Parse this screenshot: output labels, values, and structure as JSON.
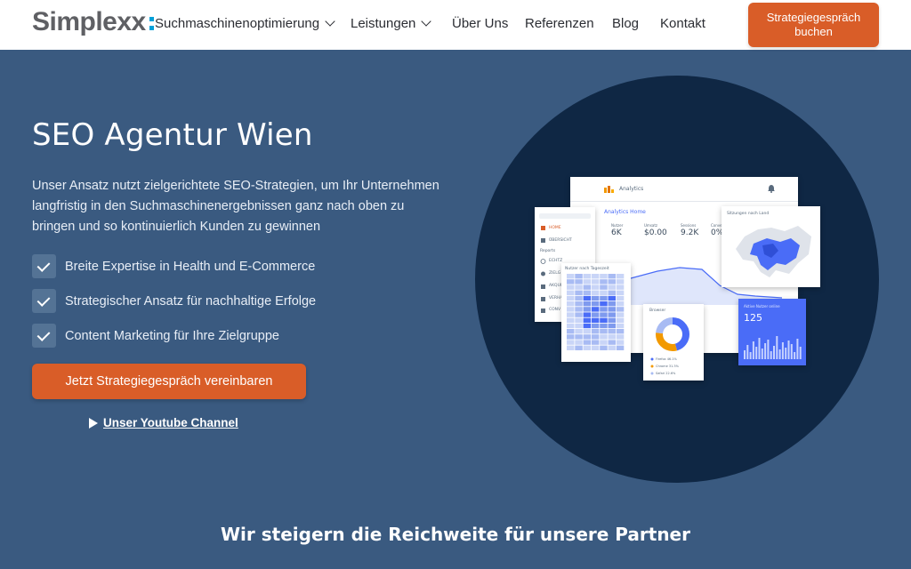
{
  "header": {
    "logo_text": "Simplexx",
    "nav": [
      {
        "label": "Suchmaschinenoptimierung",
        "has_dropdown": true
      },
      {
        "label": "Leistungen",
        "has_dropdown": true
      },
      {
        "label": "Über Uns",
        "has_dropdown": false
      },
      {
        "label": "Referenzen",
        "has_dropdown": false
      },
      {
        "label": "Blog",
        "has_dropdown": false
      },
      {
        "label": "Kontakt",
        "has_dropdown": false
      }
    ],
    "cta_line1": "Strategiegespräch",
    "cta_line2": "buchen"
  },
  "hero": {
    "title": "SEO Agentur Wien",
    "text": "Unser Ansatz nutzt zielgerichtete SEO-Strategien, um Ihr Unternehmen langfristig in den Suchmaschinenergebnissen ganz nach oben zu bringen und so kontinuierlich Kunden zu gewinnen",
    "checks": [
      "Breite Expertise in Health und E-Commerce",
      "Strategischer Ansatz für nachhaltige Erfolge",
      "Content Marketing für Ihre Zielgruppe"
    ],
    "cta": "Jetzt Strategiegespräch vereinbaren",
    "youtube_link": "Unser Youtube Channel"
  },
  "illustration": {
    "analytics_title": "Analytics",
    "analytics_home": "Analytics Home",
    "metrics": [
      {
        "label": "Nutzer",
        "value": "6K"
      },
      {
        "label": "Umsatz",
        "value": "$0.00"
      },
      {
        "label": "Sessions",
        "value": "9.2K"
      },
      {
        "label": "Conver",
        "value": "0%"
      }
    ],
    "sidebar_items": [
      "HOME",
      "ÜBERSICHT",
      "Reports",
      "ECHTZ",
      "ZIELG",
      "AKQUI",
      "VERHA",
      "CONV"
    ],
    "heatmap_title": "Nutzer nach Tageszeit",
    "map_title": "Sitzungen nach Land",
    "donut_title": "Browser",
    "donut_legend": [
      "Firefox 46.1%",
      "Chrome 31.3%",
      "Safari 22.6%"
    ],
    "users_title": "Aktive Nutzer online",
    "users_value": "125",
    "accent_color": "#4a6cf7",
    "orange": "#d95d28"
  },
  "bottom_heading": "Wir steigern die Reichweite für unsere Partner"
}
